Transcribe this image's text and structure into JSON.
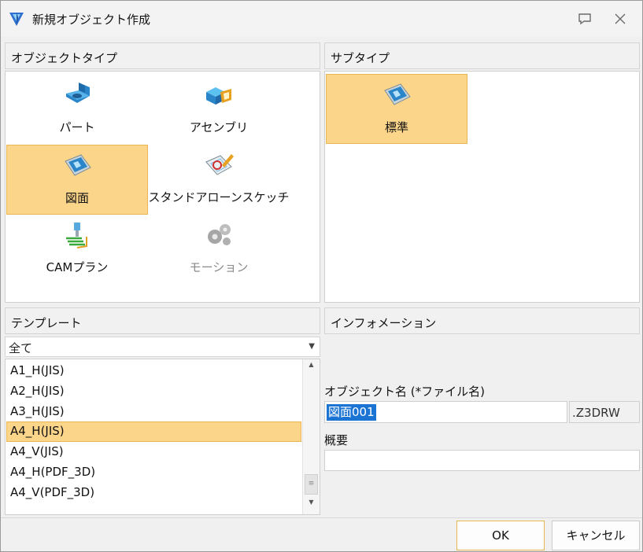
{
  "window": {
    "title": "新規オブジェクト作成",
    "ext": ".Z3DRW"
  },
  "object_type": {
    "header": "オブジェクトタイプ",
    "items": [
      {
        "label": "パート",
        "icon": "part-icon",
        "selected": false,
        "disabled": false
      },
      {
        "label": "アセンブリ",
        "icon": "assembly-icon",
        "selected": false,
        "disabled": false
      },
      {
        "label": "図面",
        "icon": "drawing-icon",
        "selected": true,
        "disabled": false
      },
      {
        "label": "スタンドアローンスケッチ",
        "icon": "sketch-icon",
        "selected": false,
        "disabled": false
      },
      {
        "label": "CAMプラン",
        "icon": "cam-plan-icon",
        "selected": false,
        "disabled": false
      },
      {
        "label": "モーション",
        "icon": "motion-icon",
        "selected": false,
        "disabled": true
      }
    ]
  },
  "subtype": {
    "header": "サブタイプ",
    "items": [
      {
        "label": "標準",
        "icon": "drawing-icon",
        "selected": true
      }
    ]
  },
  "template": {
    "header": "テンプレート",
    "filter_value": "全て",
    "items": [
      "A1_H(JIS)",
      "A2_H(JIS)",
      "A3_H(JIS)",
      "A4_H(JIS)",
      "A4_V(JIS)",
      "A4_H(PDF_3D)",
      "A4_V(PDF_3D)"
    ],
    "selected_index": 3
  },
  "info": {
    "header": "インフォメーション",
    "name_label": "オブジェクト名 (*ファイル名)",
    "name_value": "図面001",
    "desc_label": "概要",
    "desc_value": ""
  },
  "buttons": {
    "ok": "OK",
    "cancel": "キャンセル"
  },
  "colors": {
    "selection": "#fbd58a",
    "selection_border": "#e8b652",
    "text_selection": "#1b74d4"
  }
}
